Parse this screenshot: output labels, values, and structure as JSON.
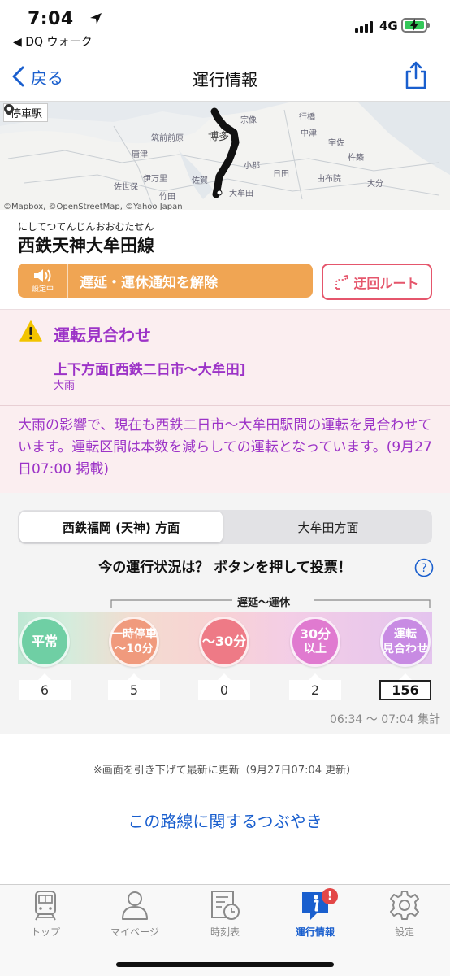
{
  "status_bar": {
    "time": "7:04",
    "back_app": "◀ DQ ウォーク",
    "network": "4G"
  },
  "nav": {
    "back_label": "戻る",
    "title": "運行情報"
  },
  "map": {
    "badge": "停車駅",
    "attribution": "©Mapbox, ©OpenStreetMap, ©Yahoo Japan",
    "place_labels": [
      "行橋",
      "中津",
      "宇佐",
      "杵築",
      "日田",
      "由布院",
      "大分",
      "唐津",
      "伊万里",
      "佐賀",
      "佐世保",
      "博多",
      "筑前前原",
      "宗像",
      "小郡",
      "竹田",
      "大牟田"
    ]
  },
  "line": {
    "reading": "にしてつてんじんおおむたせん",
    "name": "西鉄天神大牟田線"
  },
  "buttons": {
    "notify_sub": "設定中",
    "notify_label": "遅延・運休通知を解除",
    "detour_label": "迂回ルート"
  },
  "status": {
    "title": "運転見合わせ",
    "direction": "上下方面[西鉄二日市〜大牟田]",
    "cause": "大雨",
    "description": "大雨の影響で、現在も西鉄二日市〜大牟田駅間の運転を見合わせています。運転区間は本数を減らしての運転となっています。(9月27日07:00 掲載)"
  },
  "vote": {
    "tabs": [
      "西鉄福岡 (天神) 方面",
      "大牟田方面"
    ],
    "active_tab": 0,
    "prompt": "今の運行状況は？ ボタンを押して投票！",
    "range_label": "遅延〜運休",
    "options": [
      {
        "line1": "平常",
        "line2": "",
        "count": "6",
        "color": "#6fcfa4"
      },
      {
        "line1": "一時停車",
        "line2": "〜10分",
        "count": "5",
        "color": "#f09a7d"
      },
      {
        "line1": "〜30分",
        "line2": "",
        "count": "0",
        "color": "#ee7a86"
      },
      {
        "line1": "30分",
        "line2": "以上",
        "count": "2",
        "color": "#e07ad0"
      },
      {
        "line1": "運転",
        "line2": "見合わせ",
        "count": "156",
        "color": "#c88be3"
      }
    ],
    "selected_option": 4,
    "tally_period": "06:34 〜 07:04 集計"
  },
  "footer": {
    "refresh_note": "※画面を引き下げて最新に更新（9月27日07:04 更新）",
    "tweets_link": "この路線に関するつぶやき"
  },
  "tabs": [
    {
      "label": "トップ",
      "icon": "train-icon"
    },
    {
      "label": "マイページ",
      "icon": "person-icon"
    },
    {
      "label": "時刻表",
      "icon": "timetable-icon"
    },
    {
      "label": "運行情報",
      "icon": "info-icon",
      "badge": "!"
    },
    {
      "label": "設定",
      "icon": "gear-icon"
    }
  ],
  "active_tab_index": 3,
  "colors": {
    "accent_blue": "#1a5fce",
    "status_purple": "#9c33c7",
    "notify_orange": "#f0a553",
    "detour_red": "#e5566c",
    "status_bg": "#fbeef0"
  }
}
